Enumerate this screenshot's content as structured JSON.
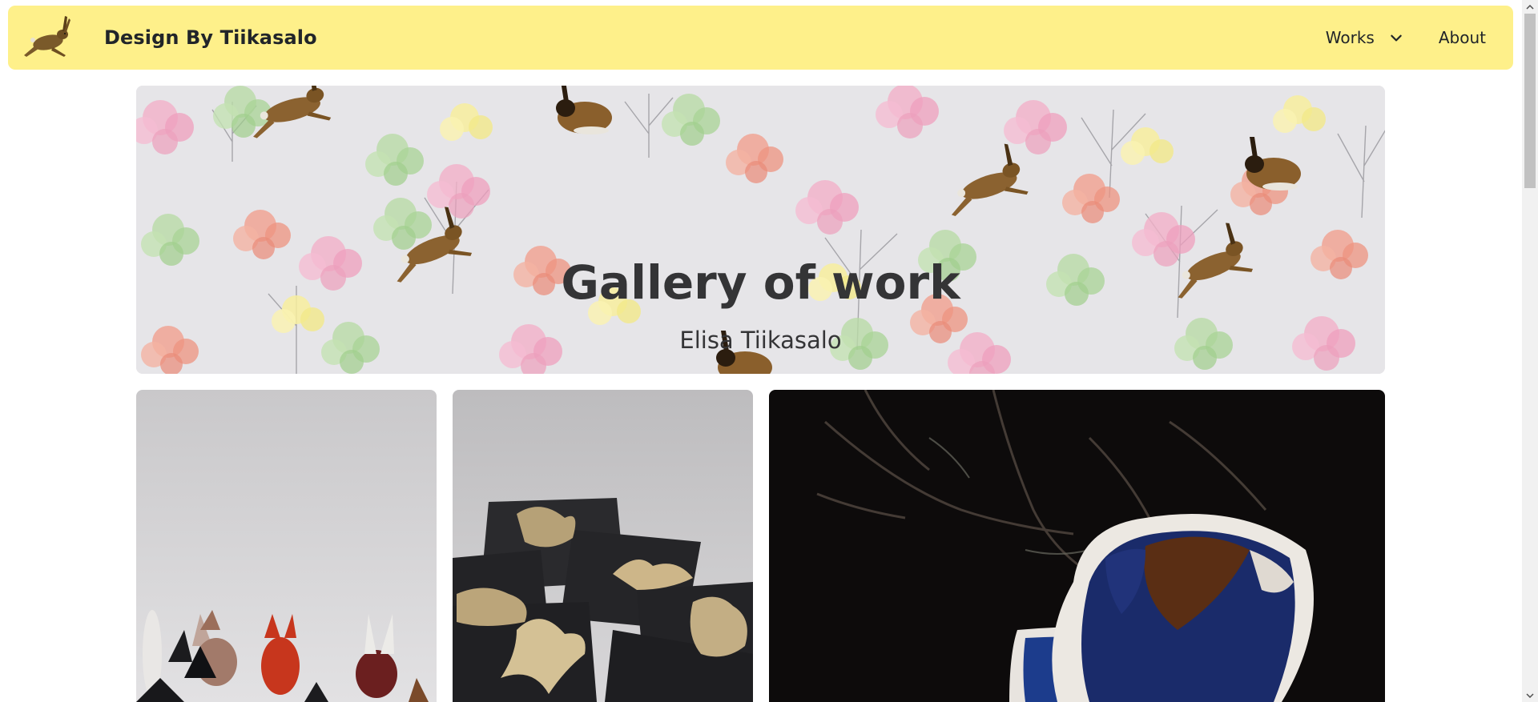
{
  "navbar": {
    "brand_text": "Design By Tiikasalo",
    "logo_icon": "hare-icon",
    "works_label": "Works",
    "about_label": "About",
    "background": "#fef08a"
  },
  "hero": {
    "title": "Gallery of work",
    "subtitle": "Elisa Tiikasalo"
  },
  "gallery": [
    {
      "image": "ceramic-rabbit-figurines-photo"
    },
    {
      "image": "brass-animal-brooches-photo"
    },
    {
      "image": "glazed-ceramic-bowls-photo"
    }
  ]
}
